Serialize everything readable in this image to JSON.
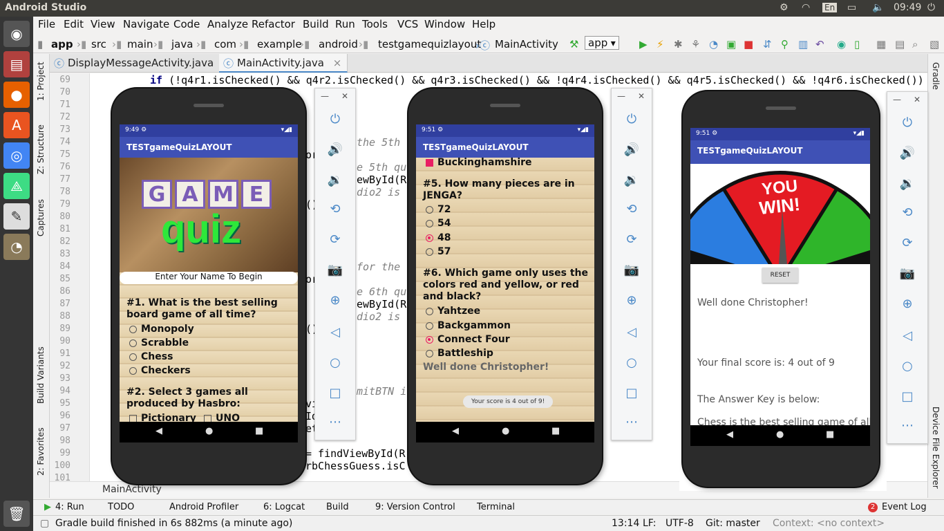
{
  "topbar": {
    "app_title": "Android Studio",
    "clock": "09:49",
    "keyboard": "En"
  },
  "menu": [
    "File",
    "Edit",
    "View",
    "Navigate",
    "Code",
    "Analyze",
    "Refactor",
    "Build",
    "Run",
    "Tools",
    "VCS",
    "Window",
    "Help"
  ],
  "nav": {
    "crumbs": [
      "app",
      "src",
      "main",
      "java",
      "com",
      "example",
      "android",
      "testgamequizlayout",
      "MainActivity"
    ],
    "run_config": "app"
  },
  "tabs": [
    {
      "label": "DisplayMessageActivity.java"
    },
    {
      "label": "MainActivity.java"
    }
  ],
  "left_tools": [
    "1: Project",
    "Z: Structure",
    "Captures",
    "Build Variants",
    "2: Favorites"
  ],
  "right_tools": [
    "Gradle",
    "Device File Explorer"
  ],
  "editor": {
    "line_numbers": [
      "69",
      "70",
      "71",
      "72",
      "73",
      "74",
      "75",
      "76",
      "77",
      "78",
      "79",
      "80",
      "81",
      "82",
      "83",
      "84",
      "85",
      "86",
      "87",
      "88",
      "89",
      "90",
      "91",
      "92",
      "93",
      "94",
      "95",
      "96",
      "97",
      "98",
      "99",
      "100",
      "101"
    ],
    "line69": "if (!q4r1.isChecked() && q4r2.isChecked() && q4r3.isChecked() && !q4r4.isChecked() && q4r5.isChecked() && !q4r6.isChecked())",
    "frag_74": "the 5th",
    "frag_75": "or",
    "frag_76": "e 5th qu",
    "frag_77": "ewById(R.",
    "frag_78": "dio2 is",
    "frag_79": "()",
    "frag_84": "for the",
    "frag_85": "or",
    "frag_86": "e 6th qu",
    "frag_87": "ewById(R.",
    "frag_88": "dio2 is",
    "frag_89": "()",
    "frag_94": "mitBTN i",
    "frag_95": "vi",
    "frag_96": "Id(R.id.",
    "frag_97": "etText()",
    "frag_99": "= findViewById(R",
    "frag_100": "rbChessGuess.isC"
  },
  "breadcrumb_bottom": "MainActivity",
  "bottom_tools": [
    "4: Run",
    "TODO",
    "Android Profiler",
    "6: Logcat",
    "Build",
    "9: Version Control",
    "Terminal",
    "Event Log"
  ],
  "event_count": "2",
  "status": {
    "message": "Gradle build finished in 6s 882ms (a minute ago)",
    "position": "13:14",
    "line_sep": "LF:",
    "encoding": "UTF-8",
    "git": "Git: master",
    "context": "Context: <no context>"
  },
  "phone1": {
    "time": "9:49",
    "app_title": "TESTgameQuizLAYOUT",
    "logo_letters": [
      "G",
      "A",
      "M",
      "E"
    ],
    "logo_word": "quiz",
    "name_hint": "Enter Your Name To Begin",
    "q1": "#1. What is the best selling board game of all time?",
    "q1_options": [
      "Monopoly",
      "Scrabble",
      "Chess",
      "Checkers"
    ],
    "q2": "#2. Select 3 games all produced by Hasbro:",
    "q2_options": [
      "Pictionary",
      "UNO"
    ]
  },
  "phone2": {
    "time": "9:51",
    "app_title": "TESTgameQuizLAYOUT",
    "prev_answer": "Buckinghamshire",
    "q5": "#5. How many pieces are in JENGA?",
    "q5_options": [
      "72",
      "54",
      "48",
      "57"
    ],
    "q5_selected": 2,
    "q6": "#6. Which game only uses the colors red and yellow, or red and black?",
    "q6_options": [
      "Yahtzee",
      "Backgammon",
      "Connect Four",
      "Battleship"
    ],
    "q6_selected": 2,
    "well_done": "Well done Christopher!",
    "toast": "Your score is 4 out of 9!"
  },
  "phone3": {
    "time": "9:51",
    "app_title": "TESTgameQuizLAYOUT",
    "wheel_text_1": "YOU",
    "wheel_text_2": "WIN!",
    "reset": "RESET",
    "well_done": "Well done Christopher!",
    "score": "Your final score is: 4 out of 9",
    "answer_key": "The Answer Key is below:",
    "answer_line": "Chess is the best selling game of all"
  },
  "colors": {
    "app_bar": "#3f51b5",
    "status_bar": "#303f9f",
    "accent": "#e91e63",
    "ide_accent": "#4a88c7"
  }
}
